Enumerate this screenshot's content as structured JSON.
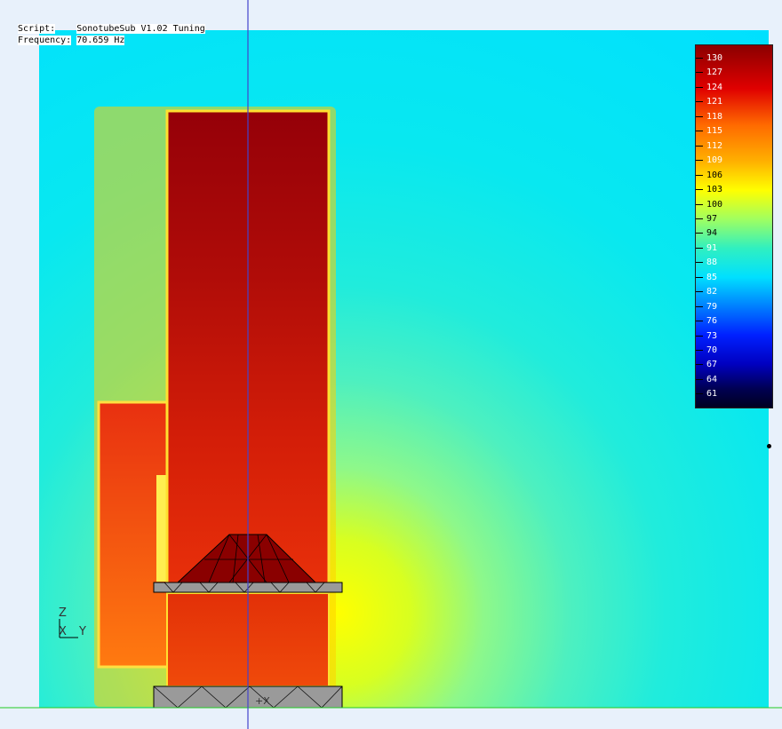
{
  "info": {
    "script_label": "Script:",
    "script_value": "SonotubeSub V1.02 Tuning",
    "frequency_label": "Frequency:",
    "frequency_value": "70.659 Hz"
  },
  "legend": {
    "ticks": [
      "130",
      "127",
      "124",
      "121",
      "118",
      "115",
      "112",
      "109",
      "106",
      "103",
      "100",
      "97",
      "94",
      "91",
      "88",
      "85",
      "82",
      "79",
      "76",
      "73",
      "70",
      "67",
      "64",
      "61"
    ]
  },
  "axes": {
    "z": "Z",
    "x": "X",
    "y": "Y",
    "origin": "+X"
  },
  "colors": {
    "background": "#e8f1fb",
    "field_low": "#00e5ff",
    "field_high": "#8b0000",
    "ground_line": "#22cc22",
    "vertical_line": "#4444cc"
  }
}
